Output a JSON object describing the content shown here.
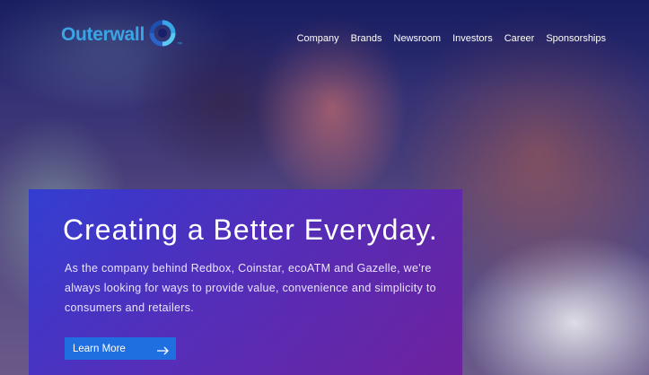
{
  "brand": {
    "name": "Outerwall",
    "tm": "™",
    "color": "#3aa5e6"
  },
  "nav": {
    "items": [
      {
        "label": "Company"
      },
      {
        "label": "Brands"
      },
      {
        "label": "Newsroom"
      },
      {
        "label": "Investors"
      },
      {
        "label": "Career"
      },
      {
        "label": "Sponsorships"
      }
    ]
  },
  "hero": {
    "headline": "Creating a Better Everyday.",
    "body": "As the company behind Redbox, Coinstar, ecoATM and Gazelle, we're always looking for ways to provide value, convenience and simplicity to consumers and retailers.",
    "cta_label": "Learn More",
    "cta_icon": "arrow-right-icon",
    "panel_colors": [
      "#2f3ad6",
      "#6e1ea0"
    ]
  }
}
